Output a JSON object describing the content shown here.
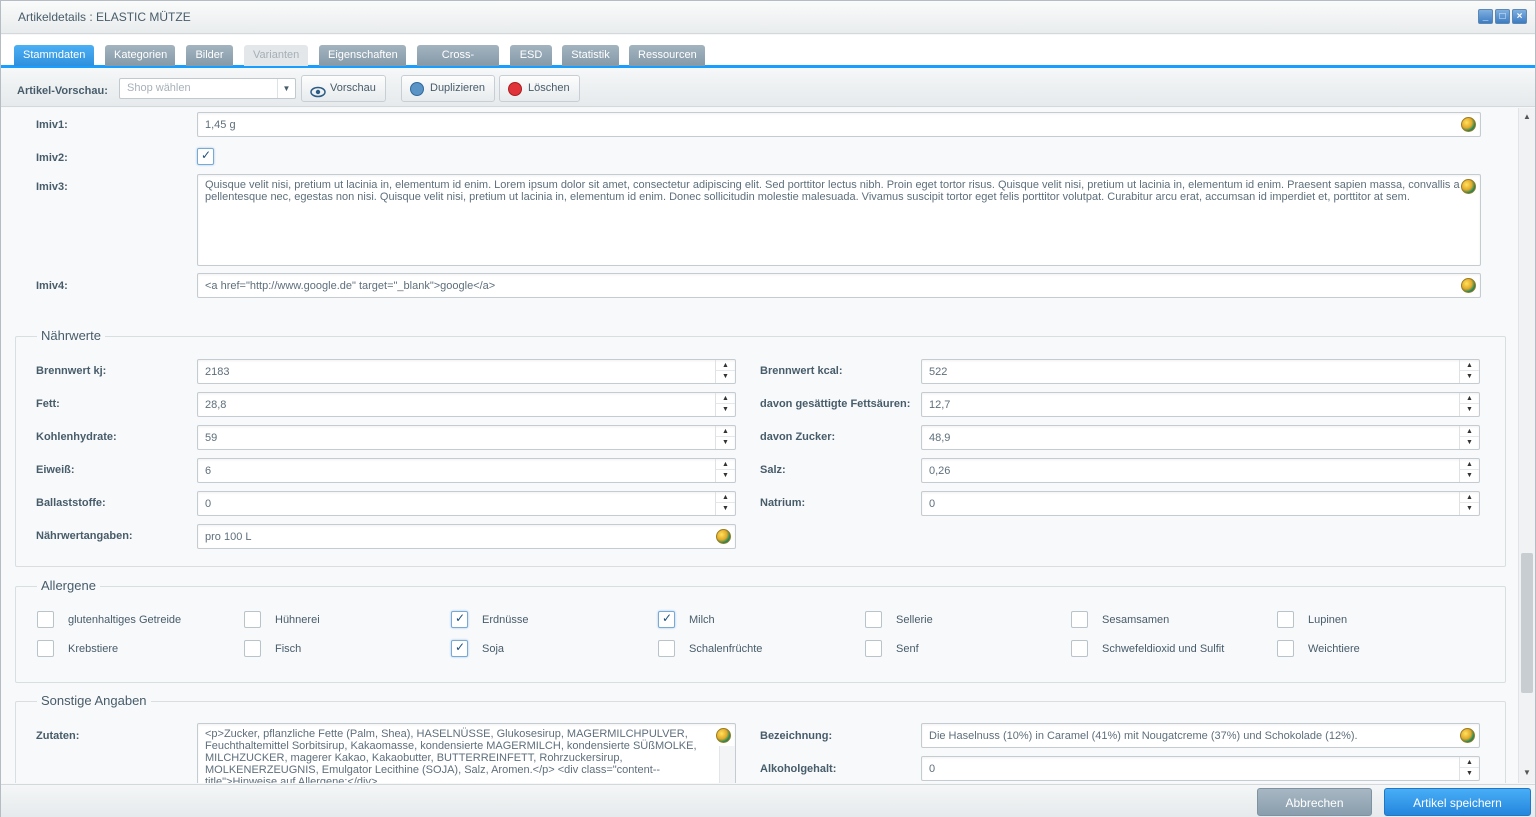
{
  "window": {
    "title": "Artikeldetails : ELASTIC MÜTZE"
  },
  "tabs": [
    {
      "label": "Stammdaten"
    },
    {
      "label": "Kategorien"
    },
    {
      "label": "Bilder"
    },
    {
      "label": "Varianten"
    },
    {
      "label": "Eigenschaften"
    },
    {
      "label": "Cross-Selling"
    },
    {
      "label": "ESD"
    },
    {
      "label": "Statistik"
    },
    {
      "label": "Ressourcen"
    }
  ],
  "toolbar": {
    "preview_label": "Artikel-Vorschau:",
    "shop_placeholder": "Shop wählen",
    "preview_button": "Vorschau",
    "duplicate_button": "Duplizieren",
    "delete_button": "Löschen"
  },
  "attributes": {
    "imiv1": {
      "label": "Imiv1:",
      "value": "1,45 g"
    },
    "imiv2": {
      "label": "Imiv2:",
      "checked": true
    },
    "imiv3": {
      "label": "Imiv3:",
      "value": "Quisque velit nisi, pretium ut lacinia in, elementum id enim. Lorem ipsum dolor sit amet, consectetur adipiscing elit. Sed porttitor lectus nibh. Proin eget tortor risus. Quisque velit nisi, pretium ut lacinia in, elementum id enim. Praesent sapien massa, convallis a pellentesque nec, egestas non nisi. Quisque velit nisi, pretium ut lacinia in, elementum id enim. Donec sollicitudin molestie malesuada. Vivamus suscipit tortor eget felis porttitor volutpat. Curabitur arcu erat, accumsan id imperdiet et, porttitor at sem."
    },
    "imiv4": {
      "label": "Imiv4:",
      "value": "<a href=\"http://www.google.de\" target=\"_blank\">google</a>"
    }
  },
  "naehrwerte": {
    "legend": "Nährwerte",
    "left": [
      {
        "label": "Brennwert kj:",
        "value": "2183"
      },
      {
        "label": "Fett:",
        "value": "28,8"
      },
      {
        "label": "Kohlenhydrate:",
        "value": "59"
      },
      {
        "label": "Eiweiß:",
        "value": "6"
      },
      {
        "label": "Ballaststoffe:",
        "value": "0"
      }
    ],
    "right": [
      {
        "label": "Brennwert kcal:",
        "value": "522"
      },
      {
        "label": "davon gesättigte Fettsäuren:",
        "value": "12,7"
      },
      {
        "label": "davon Zucker:",
        "value": "48,9"
      },
      {
        "label": "Salz:",
        "value": "0,26"
      },
      {
        "label": "Natrium:",
        "value": "0"
      }
    ],
    "angaben": {
      "label": "Nährwertangaben:",
      "value": "pro 100 L"
    }
  },
  "allergene": {
    "legend": "Allergene",
    "items": [
      {
        "label": "glutenhaltiges Getreide",
        "checked": false
      },
      {
        "label": "Hühnerei",
        "checked": false
      },
      {
        "label": "Erdnüsse",
        "checked": true
      },
      {
        "label": "Milch",
        "checked": true
      },
      {
        "label": "Sellerie",
        "checked": false
      },
      {
        "label": "Sesamsamen",
        "checked": false
      },
      {
        "label": "Lupinen",
        "checked": false
      },
      {
        "label": "Krebstiere",
        "checked": false
      },
      {
        "label": "Fisch",
        "checked": false
      },
      {
        "label": "Soja",
        "checked": true
      },
      {
        "label": "Schalenfrüchte",
        "checked": false
      },
      {
        "label": "Senf",
        "checked": false
      },
      {
        "label": "Schwefeldioxid und Sulfit",
        "checked": false
      },
      {
        "label": "Weichtiere",
        "checked": false
      }
    ]
  },
  "sonstige": {
    "legend": "Sonstige Angaben",
    "zutaten": {
      "label": "Zutaten:",
      "value": "<p>Zucker, pflanzliche Fette (Palm, Shea), HASELNÜSSE, Glukosesirup, MAGERMILCHPULVER, Feuchthaltemittel Sorbitsirup, Kakaomasse, kondensierte MAGERMILCH, kondensierte SÜßMOLKE, MILCHZUCKER, magerer Kakao, Kakaobutter, BUTTERREINFETT, Rohrzuckersirup, MOLKENERZEUGNIS, Emulgator Lecithine (SOJA), Salz, Aromen.</p> <div class=\"content--title\">Hinweise auf Allergene:</div>"
    },
    "bezeichnung": {
      "label": "Bezeichnung:",
      "value": "Die Haselnuss (10%) in Caramel (41%) mit Nougatcreme (37%) und Schokolade (12%)."
    },
    "alkohol": {
      "label": "Alkoholgehalt:",
      "value": "0"
    }
  },
  "footer": {
    "cancel": "Abbrechen",
    "save": "Artikel speichern"
  }
}
